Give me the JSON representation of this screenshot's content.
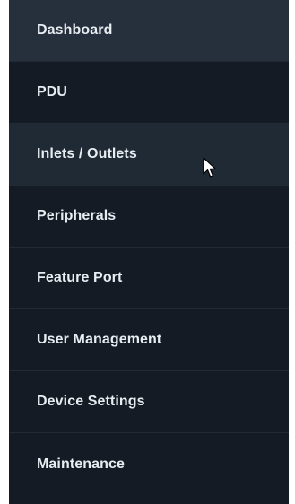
{
  "nav": {
    "items": [
      {
        "label": "Dashboard",
        "state": "section-header"
      },
      {
        "label": "PDU",
        "state": "default"
      },
      {
        "label": "Inlets / Outlets",
        "state": "hover"
      },
      {
        "label": "Peripherals",
        "state": "default"
      },
      {
        "label": "Feature Port",
        "state": "default"
      },
      {
        "label": "User Management",
        "state": "default"
      },
      {
        "label": "Device Settings",
        "state": "default"
      },
      {
        "label": "Maintenance",
        "state": "default"
      }
    ]
  },
  "cursor": {
    "icon": "mouse-pointer-icon"
  },
  "colors": {
    "menu_background": "#151b24",
    "dashboard_background": "#26303c",
    "hover_background": "#1f2a35",
    "text": "#e8edf2",
    "divider": "#222a35"
  }
}
